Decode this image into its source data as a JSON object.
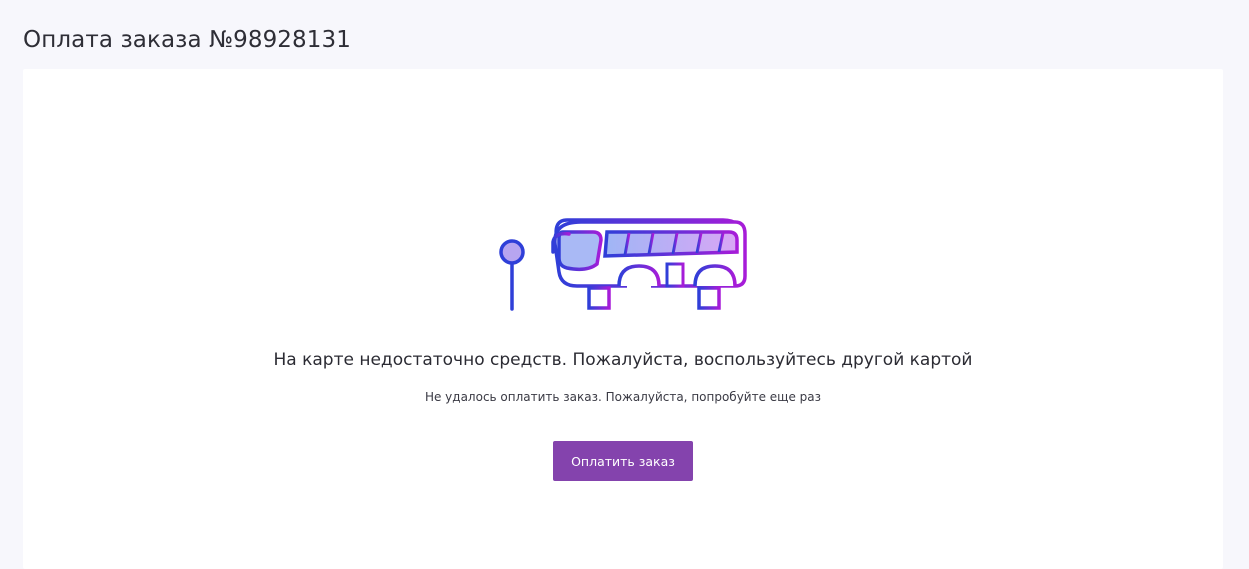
{
  "page": {
    "title": "Оплата заказа №98928131"
  },
  "error": {
    "illustration_icon": "bus-stop-icon",
    "title": "На карте недостаточно средств. Пожалуйста, воспользуйтесь другой картой",
    "subtitle": "Не удалось оплатить заказ. Пожалуйста, попробуйте еще раз"
  },
  "actions": {
    "pay_label": "Оплатить заказ"
  },
  "colors": {
    "background": "#f7f7fc",
    "card": "#ffffff",
    "button": "#8443ad",
    "gradient_start": "#2f3fd8",
    "gradient_end": "#a71cd8"
  }
}
